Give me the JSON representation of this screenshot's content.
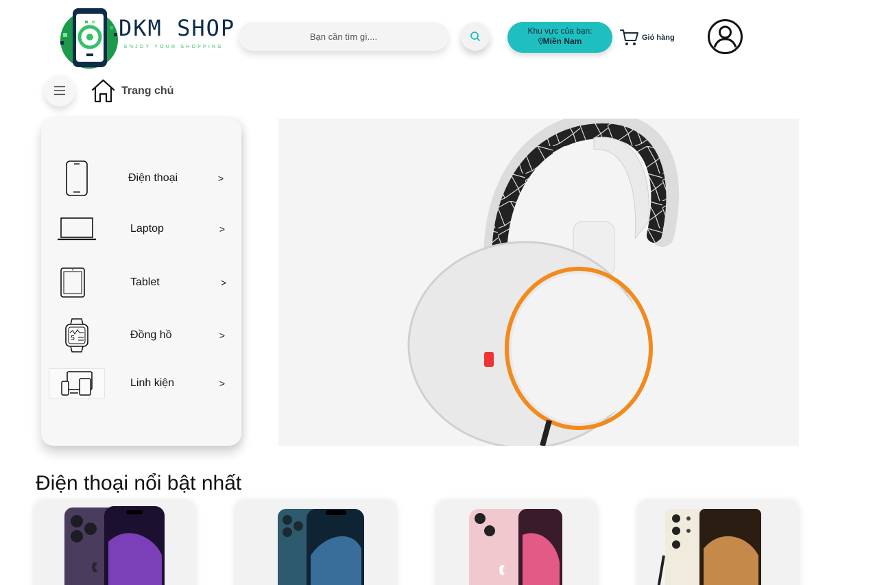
{
  "header": {
    "logo": {
      "name": "DKM SHOP",
      "tagline": "ENJOY YOUR SHOPPING"
    },
    "search": {
      "placeholder": "Bạn cần tìm gì...."
    },
    "region": {
      "label": "Khu vực của bạn:",
      "value": "Miền Nam"
    },
    "cart": {
      "label": "Giỏ hàng"
    }
  },
  "nav": {
    "home_label": "Trang chủ"
  },
  "sidebar": {
    "items": [
      {
        "label": "Điện thoại",
        "arrow": ">",
        "icon": "phone-icon"
      },
      {
        "label": "Laptop",
        "arrow": ">",
        "icon": "laptop-icon"
      },
      {
        "label": "Tablet",
        "arrow": ">",
        "icon": "tablet-icon"
      },
      {
        "label": "Đồng hồ",
        "arrow": ">",
        "icon": "smartwatch-icon"
      },
      {
        "label": "Linh kiện",
        "arrow": ">",
        "icon": "devices-icon"
      }
    ]
  },
  "featured": {
    "title": "Điện thoại nổi bật nhất",
    "products": [
      {
        "image": "iphone-14-pro-purple"
      },
      {
        "image": "iphone-12-pro-blue"
      },
      {
        "image": "iphone-13-pink"
      },
      {
        "image": "samsung-s23-ultra-cream"
      }
    ]
  },
  "colors": {
    "accent": "#1fbfbf",
    "logo_green": "#36c06a",
    "logo_navy": "#0d2b4a"
  }
}
